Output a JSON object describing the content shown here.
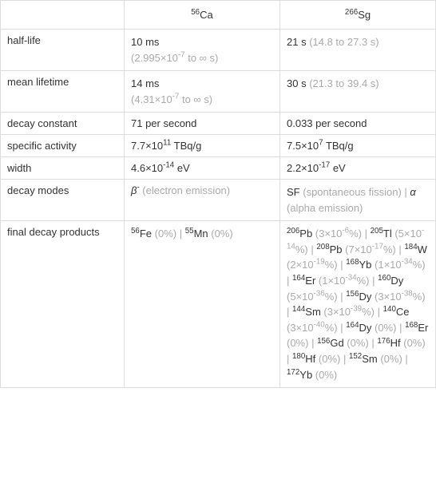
{
  "chart_data": {
    "type": "table",
    "columns": [
      "",
      "56Ca",
      "266Sg"
    ],
    "rows": [
      {
        "label": "half-life",
        "ca56": "10 ms (2.995×10^-7 to ∞ s)",
        "sg266": "21 s (14.8 to 27.3 s)"
      },
      {
        "label": "mean lifetime",
        "ca56": "14 ms (4.31×10^-7 to ∞ s)",
        "sg266": "30 s (21.3 to 39.4 s)"
      },
      {
        "label": "decay constant",
        "ca56": "71 per second",
        "sg266": "0.033 per second"
      },
      {
        "label": "specific activity",
        "ca56": "7.7×10^11 TBq/g",
        "sg266": "7.5×10^7 TBq/g"
      },
      {
        "label": "width",
        "ca56": "4.6×10^-14 eV",
        "sg266": "2.2×10^-17 eV"
      },
      {
        "label": "decay modes",
        "ca56": "β^- (electron emission)",
        "sg266": "SF (spontaneous fission) | α (alpha emission)"
      },
      {
        "label": "final decay products",
        "ca56": "56Fe (0%) | 55Mn (0%)",
        "sg266": "206Pb (3×10^-6%) | 205Tl (5×10^-14%) | 208Pb (7×10^-17%) | 184W (2×10^-19%) | 168Yb (1×10^-34%) | 164Er (1×10^-34%) | 160Dy (5×10^-36%) | 156Dy (3×10^-38%) | 144Sm (3×10^-39%) | 140Ce (3×10^-40%) | 164Dy (0%) | 168Er (0%) | 156Gd (0%) | 176Hf (0%) | 180Hf (0%) | 152Sm (0%) | 172Yb (0%)"
      }
    ]
  },
  "headers": {
    "blank": "",
    "col1_mass": "56",
    "col1_sym": "Ca",
    "col2_mass": "266",
    "col2_sym": "Sg"
  },
  "labels": {
    "halflife": "half-life",
    "meanlife": "mean lifetime",
    "decayconst": "decay constant",
    "specact": "specific activity",
    "width": "width",
    "decaymodes": "decay modes",
    "finalproducts": "final decay products"
  },
  "vals": {
    "halflife_ca_main": "10 ms",
    "halflife_ca_sub_pre": "(2.995×10",
    "halflife_ca_sub_exp": "-7",
    "halflife_ca_sub_post": " to ∞ s)",
    "halflife_sg_main": "21 s",
    "halflife_sg_sub": " (14.8 to 27.3 s)",
    "meanlife_ca_main": "14 ms",
    "meanlife_ca_sub_pre": "(4.31×10",
    "meanlife_ca_sub_exp": "-7",
    "meanlife_ca_sub_post": " to ∞ s)",
    "meanlife_sg_main": "30 s",
    "meanlife_sg_sub": " (21.3 to 39.4 s)",
    "decayconst_ca": "71 per second",
    "decayconst_sg": "0.033 per second",
    "specact_ca_pre": "7.7×10",
    "specact_ca_exp": "11",
    "specact_ca_post": " TBq/g",
    "specact_sg_pre": "7.5×10",
    "specact_sg_exp": "7",
    "specact_sg_post": " TBq/g",
    "width_ca_pre": "4.6×10",
    "width_ca_exp": "-14",
    "width_ca_post": " eV",
    "width_sg_pre": "2.2×10",
    "width_sg_exp": "-17",
    "width_sg_post": " eV",
    "decaymodes_ca_sym": "β",
    "decaymodes_ca_exp": "-",
    "decaymodes_ca_txt": " (electron emission)",
    "decaymodes_sg_sf": "SF",
    "decaymodes_sg_sf_txt": " (spontaneous fission)",
    "decaymodes_sg_sep": " | ",
    "decaymodes_sg_alpha": "α",
    "decaymodes_sg_alpha_txt": " (alpha emission)",
    "fp_ca_1_mass": "56",
    "fp_ca_1_sym": "Fe",
    "fp_ca_1_pct": " (0%)",
    "fp_ca_2_mass": "55",
    "fp_ca_2_sym": "Mn",
    "fp_ca_2_pct": " (0%)",
    "sep": " | ",
    "fp_sg": [
      {
        "mass": "206",
        "sym": "Pb",
        "pct_pre": " (3×10",
        "pct_exp": "-6",
        "pct_post": "%)"
      },
      {
        "mass": "205",
        "sym": "Tl",
        "pct_pre": " (5×10",
        "pct_exp": "-14",
        "pct_post": "%)"
      },
      {
        "mass": "208",
        "sym": "Pb",
        "pct_pre": " (7×10",
        "pct_exp": "-17",
        "pct_post": "%)"
      },
      {
        "mass": "184",
        "sym": "W",
        "pct_pre": " (2×10",
        "pct_exp": "-19",
        "pct_post": "%)"
      },
      {
        "mass": "168",
        "sym": "Yb",
        "pct_pre": " (1×10",
        "pct_exp": "-34",
        "pct_post": "%)"
      },
      {
        "mass": "164",
        "sym": "Er",
        "pct_pre": " (1×10",
        "pct_exp": "-34",
        "pct_post": "%)"
      },
      {
        "mass": "160",
        "sym": "Dy",
        "pct_pre": " (5×10",
        "pct_exp": "-36",
        "pct_post": "%)"
      },
      {
        "mass": "156",
        "sym": "Dy",
        "pct_pre": " (3×10",
        "pct_exp": "-38",
        "pct_post": "%)"
      },
      {
        "mass": "144",
        "sym": "Sm",
        "pct_pre": " (3×10",
        "pct_exp": "-39",
        "pct_post": "%)"
      },
      {
        "mass": "140",
        "sym": "Ce",
        "pct_pre": " (3×10",
        "pct_exp": "-40",
        "pct_post": "%)"
      },
      {
        "mass": "164",
        "sym": "Dy",
        "pct_pre": " (0%)",
        "pct_exp": "",
        "pct_post": ""
      },
      {
        "mass": "168",
        "sym": "Er",
        "pct_pre": " (0%)",
        "pct_exp": "",
        "pct_post": ""
      },
      {
        "mass": "156",
        "sym": "Gd",
        "pct_pre": " (0%)",
        "pct_exp": "",
        "pct_post": ""
      },
      {
        "mass": "176",
        "sym": "Hf",
        "pct_pre": " (0%)",
        "pct_exp": "",
        "pct_post": ""
      },
      {
        "mass": "180",
        "sym": "Hf",
        "pct_pre": " (0%)",
        "pct_exp": "",
        "pct_post": ""
      },
      {
        "mass": "152",
        "sym": "Sm",
        "pct_pre": " (0%)",
        "pct_exp": "",
        "pct_post": ""
      },
      {
        "mass": "172",
        "sym": "Yb",
        "pct_pre": " (0%)",
        "pct_exp": "",
        "pct_post": ""
      }
    ]
  }
}
